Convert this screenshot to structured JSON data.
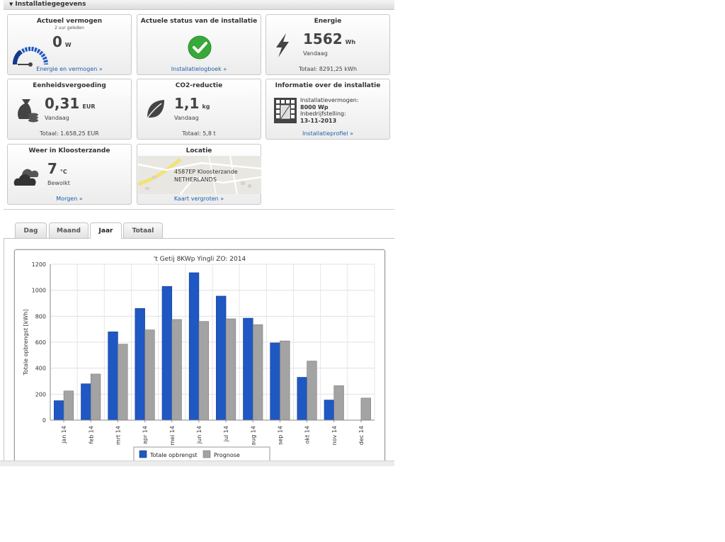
{
  "section": {
    "title": "Installatiegegevens"
  },
  "tiles": {
    "actueel": {
      "title": "Actueel vermogen",
      "subtitle": "2 uur geleden",
      "value": "0",
      "unit": "W",
      "link": "Energie en vermogen »"
    },
    "status": {
      "title": "Actuele status van de installatie",
      "link": "Installatielogboek »"
    },
    "energie": {
      "title": "Energie",
      "value": "1562",
      "unit": "Wh",
      "period": "Vandaag",
      "total": "Totaal: 8291,25 kWh"
    },
    "vergoeding": {
      "title": "Eenheidsvergoeding",
      "value": "0,31",
      "unit": "EUR",
      "period": "Vandaag",
      "total": "Totaal: 1.658,25 EUR"
    },
    "co2": {
      "title": "CO2-reductie",
      "value": "1,1",
      "unit": "kg",
      "period": "Vandaag",
      "total": "Totaal: 5,8 t"
    },
    "info": {
      "title": "Informatie over de installatie",
      "label1": "Installatievermogen:",
      "value1": "8000 Wp",
      "label2": "Inbedrijfstelling:",
      "value2": "13-11-2013",
      "link": "Installatieprofiel »"
    },
    "weer": {
      "title": "Weer in Kloosterzande",
      "value": "7",
      "unit": "°C",
      "condition": "Bewolkt",
      "link": "Morgen »"
    },
    "locatie": {
      "title": "Locatie",
      "line1": "4587EP Kloosterzande",
      "line2": "NETHERLANDS",
      "link": "Kaart vergroten »"
    }
  },
  "tabs": [
    {
      "label": "Dag"
    },
    {
      "label": "Maand"
    },
    {
      "label": "Jaar",
      "active": true
    },
    {
      "label": "Totaal"
    }
  ],
  "colors": {
    "series1": "#1f57c3",
    "series2": "#a3a3a3",
    "link": "#1f5fae",
    "ok": "#39a83a"
  },
  "chart_data": {
    "type": "bar",
    "title": "'t Getij 8KWp Yingli ZO: 2014",
    "ylabel": "Totale opbrengst [kWh]",
    "xlabel": "",
    "ylim": [
      0,
      1200
    ],
    "yticks": [
      0,
      200,
      400,
      600,
      800,
      1000,
      1200
    ],
    "grid": true,
    "legend": "bottom",
    "categories": [
      "jan 14",
      "feb 14",
      "mrt 14",
      "apr 14",
      "mei 14",
      "jun 14",
      "jul 14",
      "aug 14",
      "sep 14",
      "okt 14",
      "nov 14",
      "dec 14"
    ],
    "series": [
      {
        "name": "Totale opbrengst",
        "values": [
          150,
          280,
          680,
          860,
          1030,
          1135,
          955,
          785,
          595,
          330,
          155,
          null
        ]
      },
      {
        "name": "Prognose",
        "values": [
          225,
          355,
          585,
          695,
          775,
          760,
          780,
          735,
          610,
          455,
          265,
          170
        ]
      }
    ]
  }
}
